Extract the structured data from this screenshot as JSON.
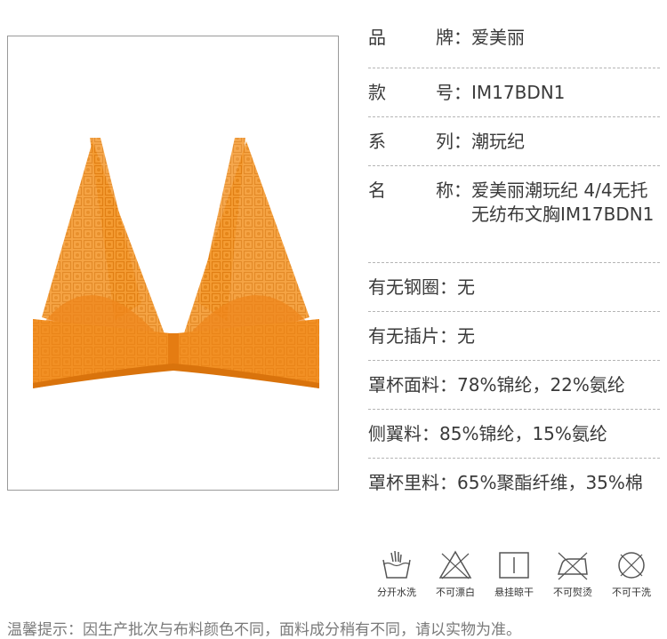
{
  "product_image": {
    "alt": "",
    "color": "#F08A1E"
  },
  "specs": [
    {
      "key1": "品",
      "key2": "牌",
      "value": "爱美丽"
    },
    {
      "key1": "款",
      "key2": "号",
      "value": "IM17BDN1"
    },
    {
      "key1": "系",
      "key2": "列",
      "value": "潮玩纪"
    },
    {
      "key1": "名",
      "key2": "称",
      "value": "爱美丽潮玩纪 4/4无托无纺布文胸IM17BDN1"
    },
    {
      "key": "有无钢圈",
      "value": "无"
    },
    {
      "key": "有无插片",
      "value": "无"
    },
    {
      "key": "罩杯面料",
      "value": "78%锦纶，22%氨纶"
    },
    {
      "key": "侧翼料",
      "value": "85%锦纶，15%氨纶"
    },
    {
      "key": "罩杯里料",
      "value": "65%聚酯纤维，35%棉"
    }
  ],
  "colon": "：",
  "care": [
    {
      "icon": "hand-wash-icon",
      "label": "分开水洗"
    },
    {
      "icon": "no-bleach-icon",
      "label": "不可漂白"
    },
    {
      "icon": "hang-dry-icon",
      "label": "悬挂晾干"
    },
    {
      "icon": "no-iron-icon",
      "label": "不可熨烫"
    },
    {
      "icon": "no-dry-clean-icon",
      "label": "不可干洗"
    }
  ],
  "notice": "温馨提示：因生产批次与布料颜色不同，面料成分稍有不同，请以实物为准。"
}
